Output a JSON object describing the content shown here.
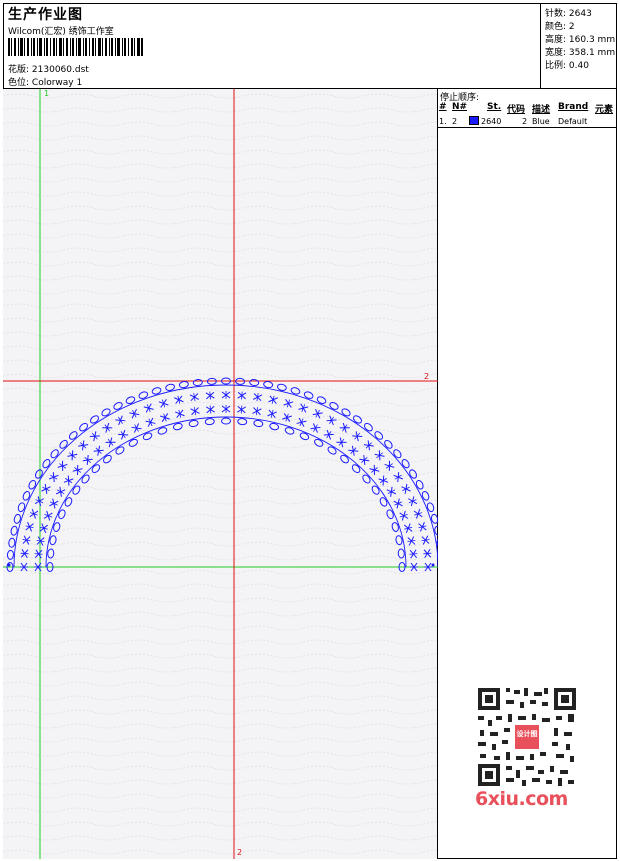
{
  "header": {
    "title": "生产作业图",
    "subtitle": "Wilcom(汇宏) 绣饰工作室",
    "design_label": "花版:",
    "design_value": "2130060.dst",
    "colorway_label": "色位:",
    "colorway_value": "Colorway 1"
  },
  "stats": [
    {
      "label": "针数:",
      "value": "2643"
    },
    {
      "label": "颜色:",
      "value": "2"
    },
    {
      "label": "高度:",
      "value": "160.3 mm"
    },
    {
      "label": "宽度:",
      "value": "358.1 mm"
    },
    {
      "label": "比例:",
      "value": "0.40"
    }
  ],
  "stop_sequence": {
    "title": "停止顺序:",
    "columns": [
      "#",
      "N#",
      "St.",
      "代码",
      "描述",
      "Brand",
      "元素"
    ],
    "rows": [
      {
        "num": "1.",
        "needle": "2",
        "stitches": "2640",
        "code": "2",
        "description": "Blue",
        "brand": "Default",
        "color": "#1a1aff"
      }
    ]
  },
  "guides": {
    "vertical_green_label": "1",
    "vertical_red_label": "2",
    "horizontal_red_label": "2"
  },
  "colors": {
    "thread": "#1a1aff",
    "guide_green": "#22cc22",
    "guide_red": "#e01010",
    "watermark": "#e8505b"
  },
  "watermark": {
    "text": "6xiu.com",
    "stamp_text": "设计图"
  }
}
